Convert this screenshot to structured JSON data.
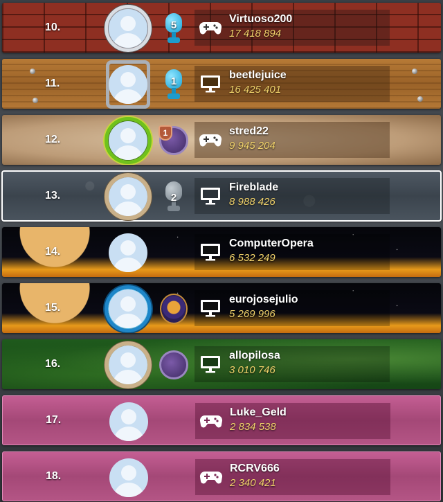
{
  "leaderboard": {
    "rows": [
      {
        "rank": "10.",
        "name": "Virtuoso200",
        "score": "17 418 894",
        "platform_icon": "gamepad-icon",
        "badge_number": "5",
        "badge_icon": "blue-trophy-icon"
      },
      {
        "rank": "11.",
        "name": "beetlejuice",
        "score": "16 425 401",
        "platform_icon": "monitor-icon",
        "badge_number": "1",
        "badge_icon": "blue-trophy-icon"
      },
      {
        "rank": "12.",
        "name": "stred22",
        "score": "9 945 204",
        "platform_icon": "gamepad-icon",
        "badge_number": "1",
        "badge_icon": "purple-medal-icon"
      },
      {
        "rank": "13.",
        "name": "Fireblade",
        "score": "8 988 426",
        "platform_icon": "monitor-icon",
        "badge_number": "2",
        "badge_icon": "silver-trophy-icon",
        "highlighted": true
      },
      {
        "rank": "14.",
        "name": "ComputerOpera",
        "score": "6 532 249",
        "platform_icon": "monitor-icon"
      },
      {
        "rank": "15.",
        "name": "eurojosejulio",
        "score": "5 269 996",
        "platform_icon": "monitor-icon",
        "badge_icon": "pharaoh-medal-icon"
      },
      {
        "rank": "16.",
        "name": "allopilosa",
        "score": "3 010 746",
        "platform_icon": "monitor-icon",
        "badge_icon": "purple-medal-icon"
      },
      {
        "rank": "17.",
        "name": "Luke_Geld",
        "score": "2 834 538",
        "platform_icon": "gamepad-icon"
      },
      {
        "rank": "18.",
        "name": "RCRV666",
        "score": "2 340 421",
        "platform_icon": "gamepad-icon"
      }
    ]
  },
  "colors": {
    "score": "#f2d36b",
    "name": "#ffffff",
    "highlight_outline": "#ffffff"
  }
}
